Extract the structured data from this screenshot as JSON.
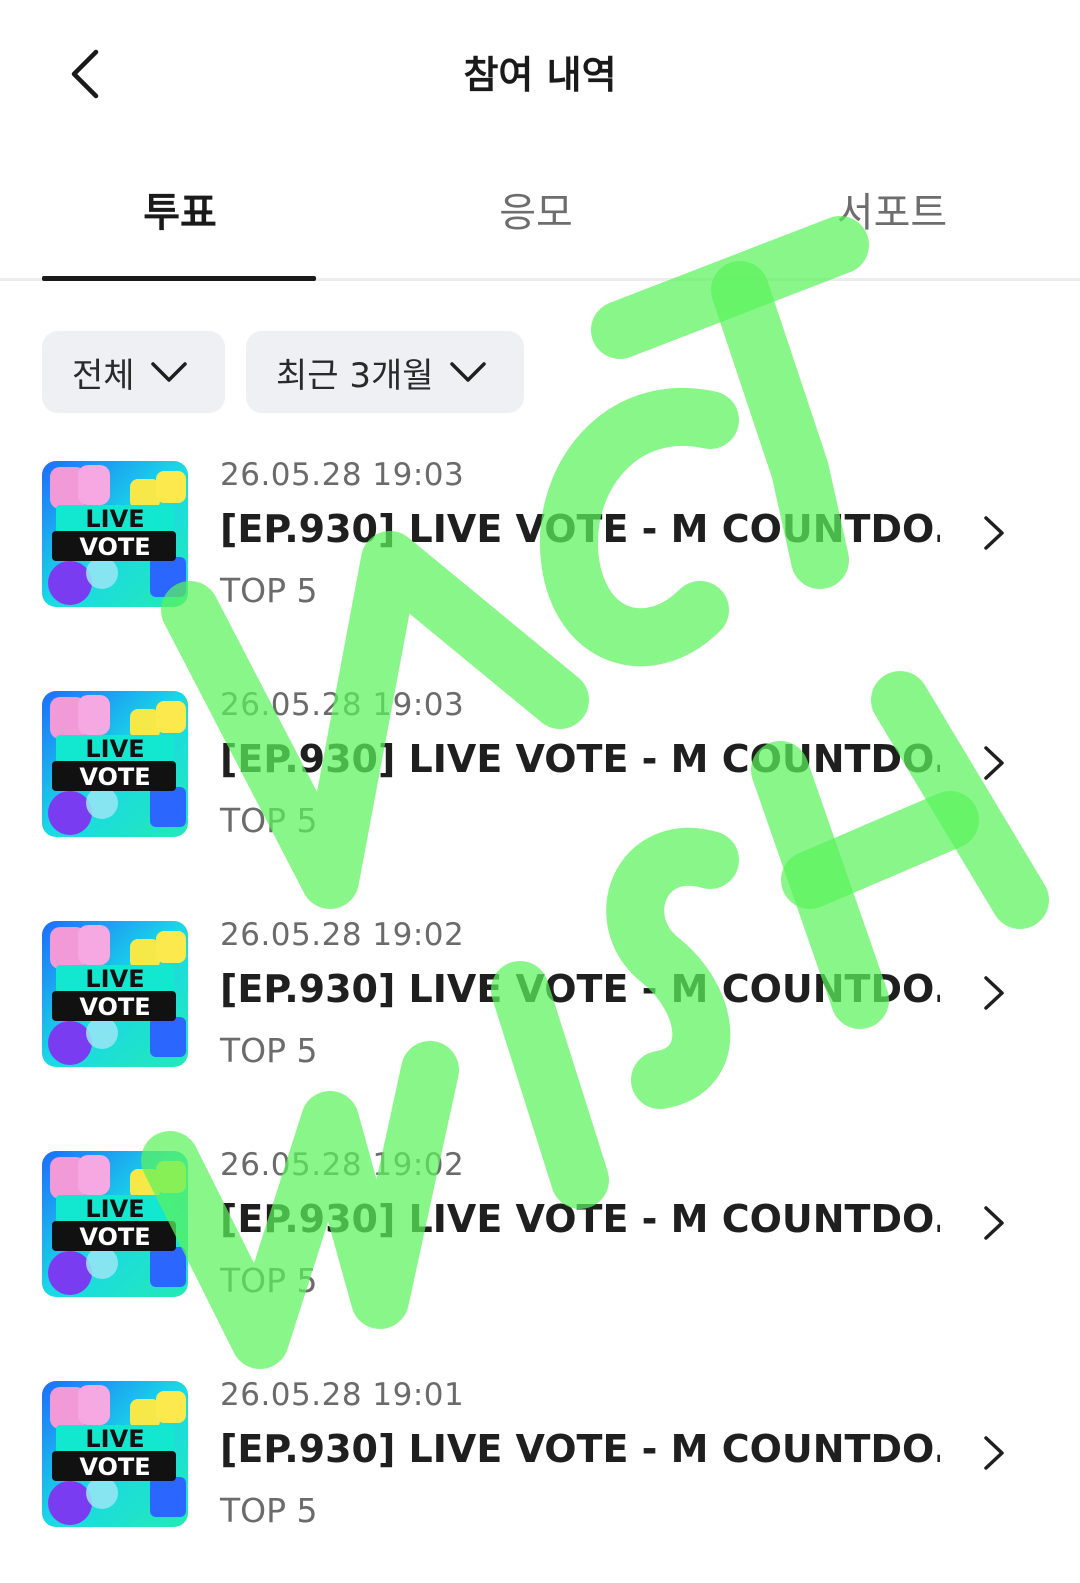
{
  "header": {
    "title": "참여 내역",
    "back_icon": "chevron-left-icon"
  },
  "tabs": [
    {
      "label": "투표",
      "active": true
    },
    {
      "label": "응모",
      "active": false
    },
    {
      "label": "서포트",
      "active": false
    }
  ],
  "filters": [
    {
      "label": "전체",
      "icon": "chevron-down-icon"
    },
    {
      "label": "최근 3개월",
      "icon": "chevron-down-icon"
    }
  ],
  "thumbnail": {
    "line1": "LIVE",
    "line2": "VOTE"
  },
  "items": [
    {
      "date": "26.05.28 19:03",
      "title": "[EP.930] LIVE VOTE - M COUNTDO...",
      "rank": "TOP 5"
    },
    {
      "date": "26.05.28 19:03",
      "title": "[EP.930] LIVE VOTE - M COUNTDO...",
      "rank": "TOP 5"
    },
    {
      "date": "26.05.28 19:02",
      "title": "[EP.930] LIVE VOTE - M COUNTDO...",
      "rank": "TOP 5"
    },
    {
      "date": "26.05.28 19:02",
      "title": "[EP.930] LIVE VOTE - M COUNTDO...",
      "rank": "TOP 5"
    },
    {
      "date": "26.05.28 19:01",
      "title": "[EP.930] LIVE VOTE - M COUNTDO...",
      "rank": "TOP 5"
    }
  ],
  "watermark": {
    "text": "NCT WISH",
    "color": "#5cf25c"
  },
  "colors": {
    "text_primary": "#1f1f1f",
    "text_secondary": "#6b6b6b",
    "filter_bg": "#eef0f3",
    "tab_indicator": "#1a1a1a"
  }
}
